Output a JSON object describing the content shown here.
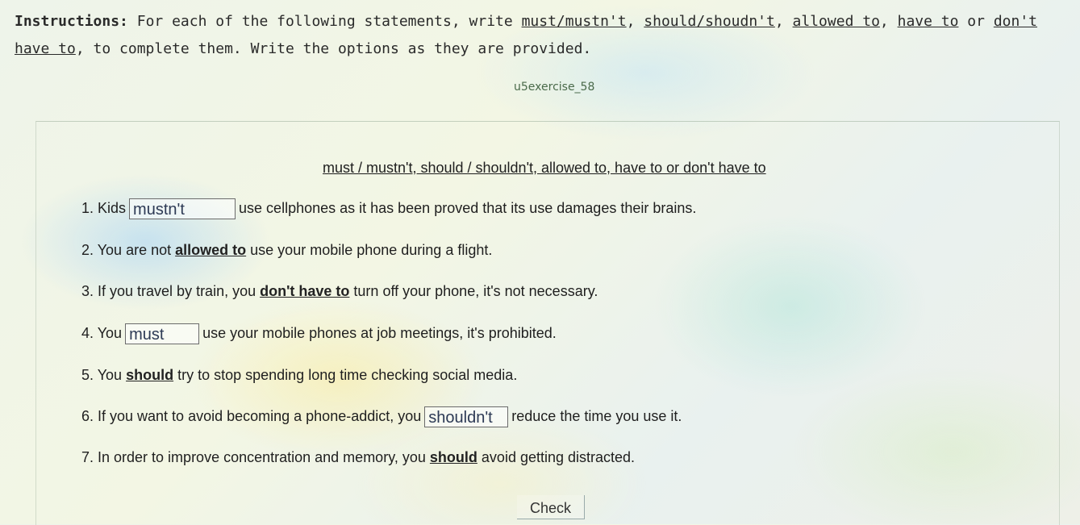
{
  "instructions": {
    "label": "Instructions:",
    "text_before": " For each of the following statements, write ",
    "opt1": "must/mustn't",
    "sep1": ", ",
    "opt2": "should/shoudn't",
    "sep2": ", ",
    "opt3": "allowed to",
    "sep3": ", ",
    "opt4": "have to",
    "sep4": " or ",
    "opt5": "don't have to",
    "text_after": ", to complete them. Write the options as they are provided."
  },
  "exercise_id": "u5exercise_58",
  "options_line": "must / mustn't, should / shouldn't, allowed to, have to or don't have to",
  "items": [
    {
      "pre": "1. Kids",
      "answer": "mustn't",
      "post": "use cellphones as it has been proved that its use damages their brains."
    },
    {
      "pre": "2. You are not",
      "answer": "allowed to",
      "post": "use your mobile phone during a flight."
    },
    {
      "pre": "3. If you travel by train, you",
      "answer": "don't have to",
      "post": "turn off your phone, it's not necessary."
    },
    {
      "pre": "4. You",
      "answer": "must",
      "post": "use your mobile phones at job meetings, it's prohibited."
    },
    {
      "pre": "5. You",
      "answer": "should",
      "post": "try to stop spending long time checking social media."
    },
    {
      "pre": "6. If you want to avoid becoming a phone-addict, you",
      "answer": "shouldn't",
      "post": "reduce the time you use it."
    },
    {
      "pre": "7. In order to improve concentration and memory, you",
      "answer": "should",
      "post": "avoid getting distracted."
    }
  ],
  "check_label": "Check"
}
